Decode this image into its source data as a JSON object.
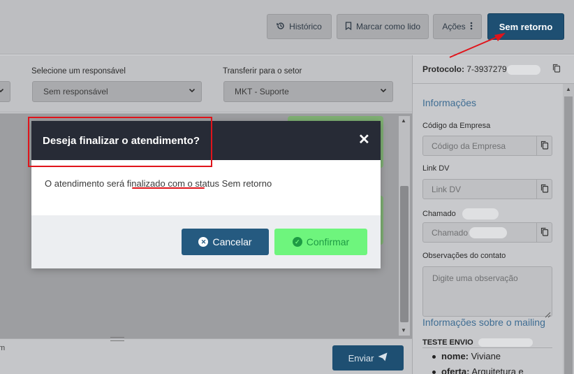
{
  "toolbar": {
    "historico_label": "Histórico",
    "marcar_lido_label": "Marcar como lido",
    "acoes_label": "Ações",
    "sem_retorno_label": "Sem retorno"
  },
  "assign": {
    "responsavel_label": "Selecione um responsável",
    "responsavel_value": "Sem responsável",
    "setor_label": "Transferir para o setor",
    "setor_value": "MKT - Suporte"
  },
  "composer": {
    "partial_text": "m",
    "send_label": "Enviar"
  },
  "sidebar": {
    "protocolo_label": "Protocolo:",
    "protocolo_value": "7-3937279",
    "informacoes_title": "Informações",
    "codigo_label": "Código da Empresa",
    "codigo_placeholder": "Código da Empresa",
    "link_label": "Link DV",
    "link_placeholder": "Link DV",
    "chamado_label": "Chamado",
    "chamado_placeholder": "Chamado",
    "obs_label": "Observações do contato",
    "obs_placeholder": "Digite uma observação",
    "mailing_title": "Informações sobre o mailing",
    "mailing_head": "TESTE ENVIO",
    "mailing_items": [
      {
        "key": "nome:",
        "value": "Viviane"
      },
      {
        "key": "oferta:",
        "value": "Arquitetura e"
      }
    ]
  },
  "modal": {
    "title": "Deseja finalizar o atendimento?",
    "close_glyph": "✕",
    "message_pre": "O atendimento será ",
    "message_mid": "finalizado com o",
    "message_post": " status Sem retorno",
    "cancel_label": "Cancelar",
    "confirm_label": "Confirmar"
  },
  "colors": {
    "primary": "#1e4f72",
    "modal_header": "#272b36",
    "confirm": "#6ef57d",
    "annotation": "#e0141b",
    "link_blue": "#3f6d93"
  }
}
